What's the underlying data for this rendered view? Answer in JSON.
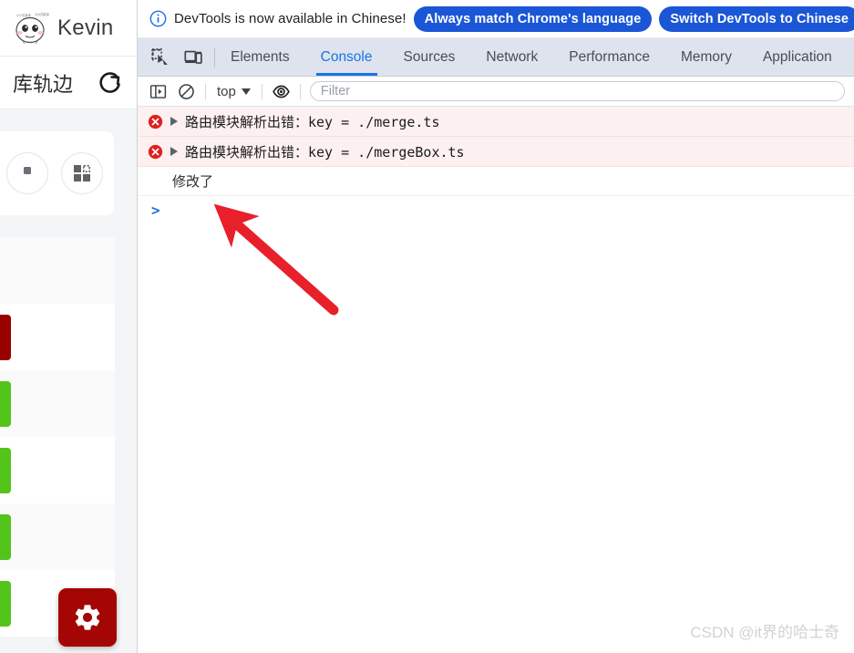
{
  "webpage": {
    "user_name": "Kevin",
    "avatar_icon": "cartoon-face-avatar",
    "subbar_text": "库轨边",
    "refresh_icon": "refresh-icon",
    "grid_button_icon": "qr-grid-icon",
    "fab_icon": "gear-icon",
    "colors": {
      "fab_bg": "#a40606",
      "bar_dark_red": "#990000",
      "bar_green": "#52c41a",
      "page_bg": "#f4f5f7"
    },
    "list_rows": [
      {
        "bar_color": "",
        "alt": true
      },
      {
        "bar_color": "#990000",
        "alt": false
      },
      {
        "bar_color": "#52c41a",
        "alt": true
      },
      {
        "bar_color": "#52c41a",
        "alt": false
      },
      {
        "bar_color": "#52c41a",
        "alt": true
      },
      {
        "bar_color": "#52c41a",
        "alt": false
      }
    ]
  },
  "devtools": {
    "banner": {
      "info_icon": "info-circle-icon",
      "text": "DevTools is now available in Chinese!",
      "primary_button": "Always match Chrome's language",
      "secondary_button": "Switch DevTools to Chinese"
    },
    "tools": {
      "inspect_icon": "inspect-element-icon",
      "device_toolbar_icon": "device-toolbar-icon"
    },
    "tabs": [
      {
        "label": "Elements",
        "active": false
      },
      {
        "label": "Console",
        "active": true
      },
      {
        "label": "Sources",
        "active": false
      },
      {
        "label": "Network",
        "active": false
      },
      {
        "label": "Performance",
        "active": false
      },
      {
        "label": "Memory",
        "active": false
      },
      {
        "label": "Application",
        "active": false
      }
    ],
    "console_toolbar": {
      "sidebar_icon": "console-sidebar-icon",
      "clear_icon": "clear-console-icon",
      "context": "top",
      "eye_icon": "live-expression-eye-icon",
      "filter_placeholder": "Filter",
      "filter_value": ""
    },
    "messages": [
      {
        "level": "error",
        "icon": "error-circle-x-icon",
        "expandable": true,
        "text": "路由模块解析出错：key = ./merge.ts"
      },
      {
        "level": "error",
        "icon": "error-circle-x-icon",
        "expandable": true,
        "text": "路由模块解析出错：key = ./mergeBox.ts"
      },
      {
        "level": "log",
        "icon": "",
        "expandable": false,
        "text": "修改了"
      }
    ],
    "prompt_symbol": ">",
    "accent_color": "#1a73e8",
    "error_bg": "#fcf0f0",
    "banner_button_color": "#1a56d6"
  },
  "annotation": {
    "arrow_color": "#e8202a",
    "arrow_from": "366,340",
    "arrow_to": "245,232"
  },
  "watermark": "CSDN @it界的哈士奇"
}
